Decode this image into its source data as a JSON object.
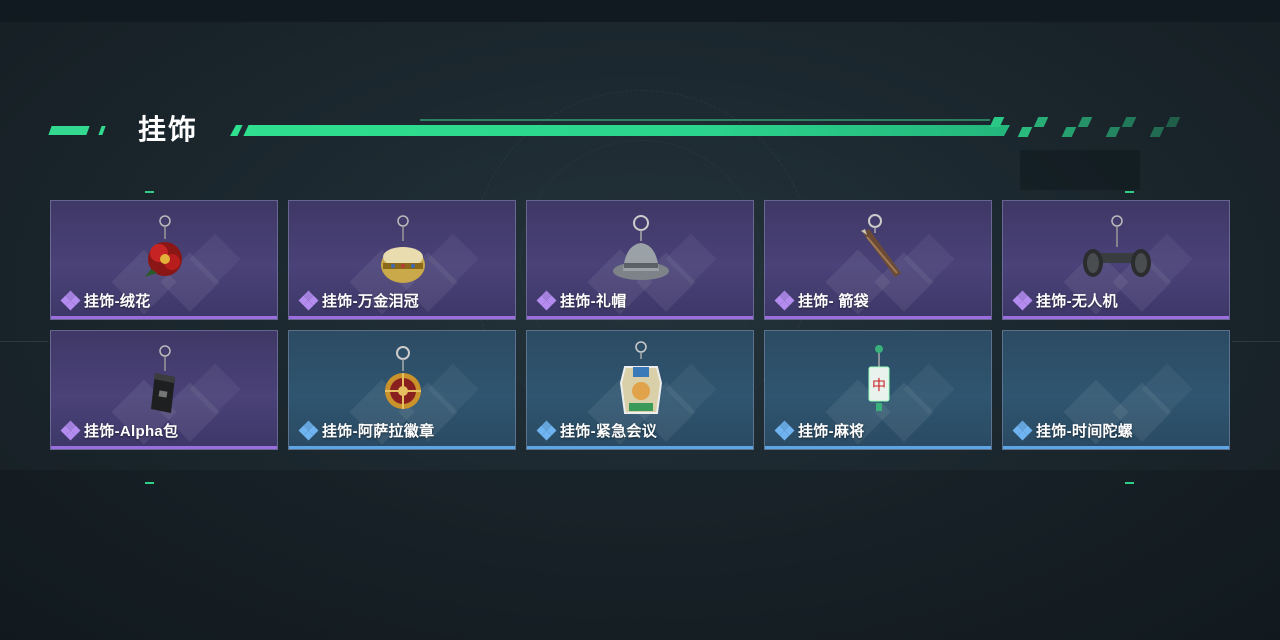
{
  "header": {
    "title": "挂饰"
  },
  "items": [
    {
      "name": "挂饰-绒花",
      "icon": "velvet-flower-charm-icon",
      "rarity": "purple"
    },
    {
      "name": "挂饰-万金泪冠",
      "icon": "golden-crown-charm-icon",
      "rarity": "purple"
    },
    {
      "name": "挂饰-礼帽",
      "icon": "top-hat-charm-icon",
      "rarity": "purple"
    },
    {
      "name": "挂饰- 箭袋",
      "icon": "quiver-charm-icon",
      "rarity": "purple"
    },
    {
      "name": "挂饰-无人机",
      "icon": "drone-charm-icon",
      "rarity": "purple"
    },
    {
      "name": "挂饰-Alpha包",
      "icon": "alpha-bag-charm-icon",
      "rarity": "purple"
    },
    {
      "name": "挂饰-阿萨拉徽章",
      "icon": "asara-badge-charm-icon",
      "rarity": "blue"
    },
    {
      "name": "挂饰-紧急会议",
      "icon": "emergency-meeting-charm-icon",
      "rarity": "blue"
    },
    {
      "name": "挂饰-麻将",
      "icon": "mahjong-charm-icon",
      "rarity": "blue"
    },
    {
      "name": "挂饰-时间陀螺",
      "icon": "time-spinner-charm-icon",
      "rarity": "blue"
    }
  ],
  "colors": {
    "accent": "#33d98f",
    "purple": "#9b6ee0",
    "blue": "#5ea5e6"
  }
}
